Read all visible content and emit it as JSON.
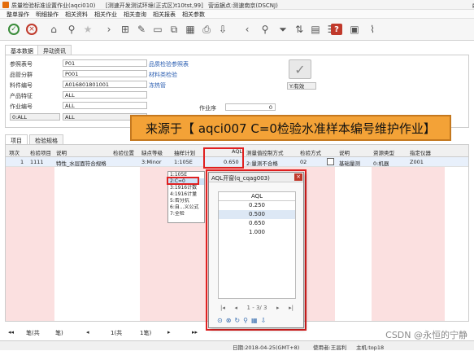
{
  "window": {
    "title": "质量检验标准设置作业(aqci010)",
    "env": "[测速开发测试环境(正式区)t10tst,99]",
    "site": "营运据点:测速南京(DSCNJ)",
    "controls": [
      "—",
      "□",
      "×"
    ]
  },
  "menu": [
    "整单操作",
    "明细操作",
    "相关资料",
    "相关作业",
    "相关查询",
    "相关报表",
    "相关参数"
  ],
  "toolbar_icons": [
    "confirm-icon",
    "cancel-icon",
    "home-icon",
    "location-icon",
    "star-icon",
    "new-icon",
    "edit-icon",
    "delete-icon",
    "copy-icon",
    "query-icon",
    "filter-icon",
    "attach-icon",
    "help-icon",
    "link-icon"
  ],
  "tabs_top": [
    "基本数据",
    "异动资讯"
  ],
  "form": {
    "fields": [
      {
        "label": "参照表号",
        "value": "P01"
      },
      {
        "label": "品管分群",
        "value": "P001"
      },
      {
        "label": "料件编号",
        "value": "A016801801001"
      },
      {
        "label": "产品特征",
        "value": "ALL"
      },
      {
        "label": "作业编号",
        "value": "ALL"
      }
    ],
    "links": [
      "品质检验参照表",
      "材料类检验",
      "冻热管"
    ],
    "op_value": "0:ALL",
    "op_value2": "ALL",
    "seq_label": "作业序",
    "seq_value": "0",
    "status_select": "Y:有效"
  },
  "tabs_bottom": [
    "项目",
    "检验规格"
  ],
  "grid": {
    "headers": [
      "项次",
      "检验项目",
      "说明",
      "检验位置",
      "缺点等级",
      "抽样计划",
      "AQL",
      "测量值控制方式",
      "检验方式",
      "说明",
      "资源类型",
      "指定仪器"
    ],
    "row": [
      "1",
      "1111",
      "特性_水层面符合规格",
      "",
      "3:Minor",
      "1:105E",
      "0.650",
      "2:量测不合格",
      "02",
      "基础量测",
      "0:机器",
      "Z001"
    ]
  },
  "dropdown": [
    "1:105E",
    "2:C=0",
    "3:1916计数",
    "4:1916计量",
    "5:否分抗",
    "6:自...义公式",
    "7:全检"
  ],
  "callout": "来源于【 aqci007  C=0检验水准样本编号维护作业】",
  "aql_window": {
    "title": "AQL开窗(q_cqag003)",
    "header": "AQL",
    "values": [
      "0.250",
      "0.500",
      "0.650",
      "1.000"
    ],
    "pager": "1 - 3/ 3"
  },
  "bottom": {
    "total": "笔(共",
    "left": "笔)",
    "page1": "1",
    "pages": "1(共",
    "pages_end": "1笔)",
    "of": "1"
  },
  "status": {
    "date": "日期:2018-04-25(GMT+8)",
    "user": "使用者:王昌利",
    "host": "主机:top18"
  },
  "watermark": "CSDN @永恒的宁静"
}
